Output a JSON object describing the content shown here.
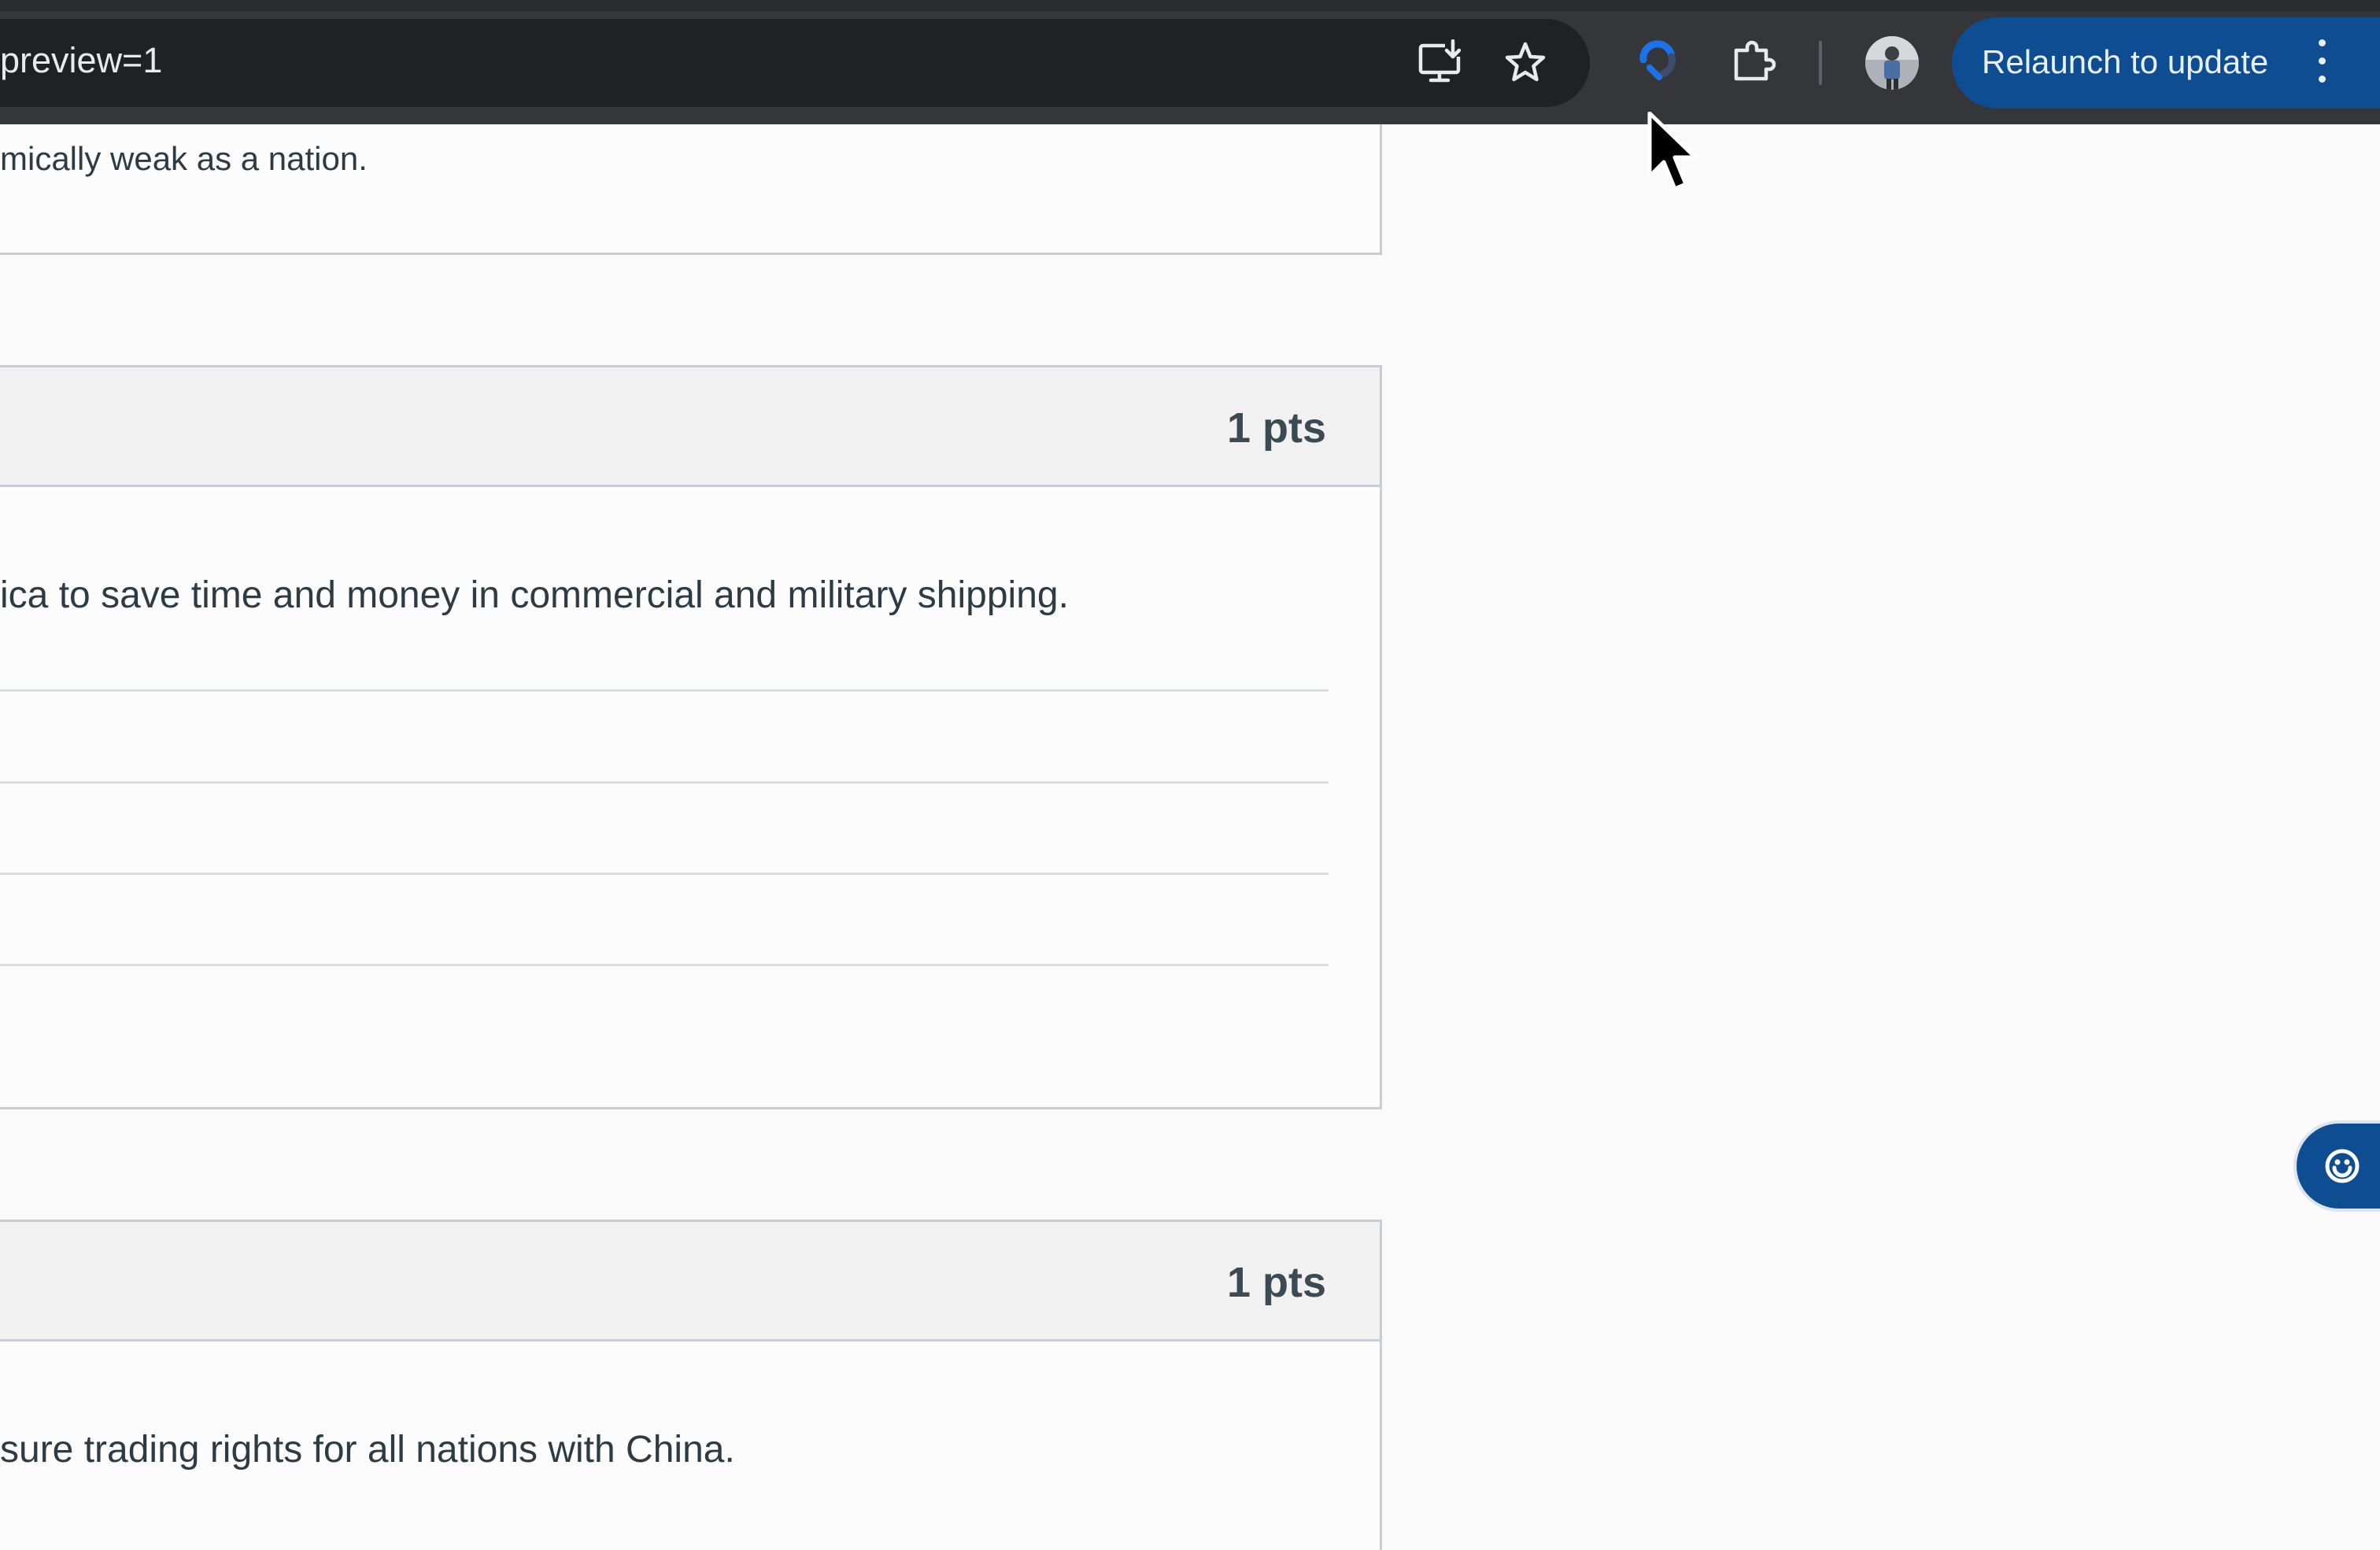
{
  "browser": {
    "url_fragment": "preview=1",
    "relaunch_label": "Relaunch to update",
    "icons": {
      "install": "install-app-icon",
      "bookmark": "bookmark-star-icon",
      "extension_active": "extension-icon",
      "extensions": "puzzle-piece-icon",
      "profile": "avatar",
      "menu": "more-vertical-icon"
    },
    "colors": {
      "toolbar": "#35363a",
      "omnibox": "#202124",
      "relaunch": "#0e4d91"
    }
  },
  "quiz": {
    "previous_question_tail": "mically weak as a nation.",
    "questions": [
      {
        "points_label": "1 pts",
        "text": "ica to save time and money in commercial and military shipping."
      },
      {
        "points_label": "1 pts",
        "text": "sure trading rights for all nations with China."
      }
    ]
  },
  "floating_button": {
    "icon": "assistant-icon",
    "color": "#0e4d91"
  }
}
